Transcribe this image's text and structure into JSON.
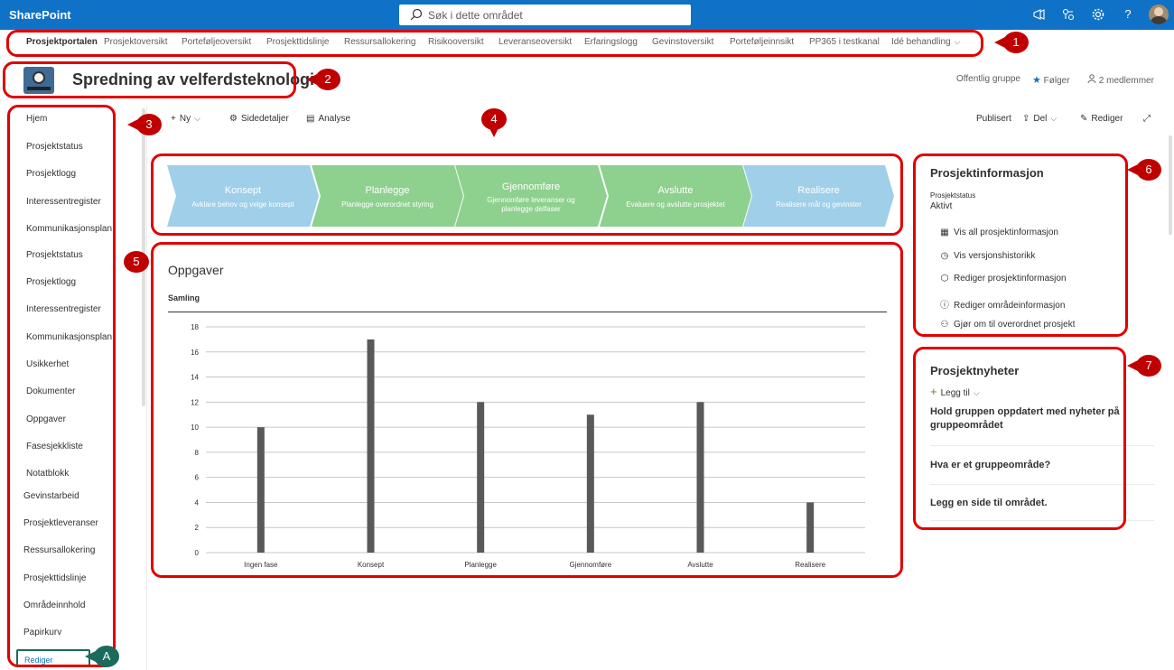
{
  "suitebar": {
    "brand": "SharePoint",
    "search_placeholder": "Søk i dette området",
    "icons": [
      "megaphone-icon",
      "share-icon",
      "gear-icon",
      "help-icon",
      "avatar"
    ]
  },
  "hubnav": {
    "items": [
      "Prosjektportalen",
      "Prosjektoversikt",
      "Porteføljeoversikt",
      "Prosjekttidslinje",
      "Ressursallokering",
      "Risikooversikt",
      "Leveranseoversikt",
      "Erfaringslogg",
      "Gevinstoversikt",
      "Porteføljeinnsikt",
      "PP365 i testkanal",
      "Idé behandling"
    ]
  },
  "site": {
    "title": "Spredning av velferdsteknologi",
    "group_type": "Offentlig gruppe",
    "follow": "Følger",
    "members": "2 medlemmer"
  },
  "leftnav": {
    "items": [
      "Hjem",
      "Prosjektstatus",
      "Prosjektlogg",
      "Interessentregister",
      "Kommunikasjonsplan",
      "Prosjektstatus",
      "Prosjektlogg",
      "Interessentregister",
      "Kommunikasjonsplan",
      "Usikkerhet",
      "Dokumenter",
      "Oppgaver",
      "Fasesjekkliste",
      "Notatblokk",
      "Gevinstarbeid",
      "Prosjektleveranser",
      "Ressursallokering",
      "Prosjekttidslinje",
      "Områdeinnhold",
      "Papirkurv"
    ],
    "edit": "Rediger"
  },
  "commandbar": {
    "new": "Ny",
    "page_details": "Sidedetaljer",
    "analytics": "Analyse",
    "published": "Publisert",
    "share": "Del",
    "edit": "Rediger"
  },
  "phases": [
    {
      "title": "Konsept",
      "desc": "Avklare behov og velge konsept",
      "color": "#9fcfe9"
    },
    {
      "title": "Planlegge",
      "desc": "Planlegge overordnet styring",
      "color": "#8ed08e"
    },
    {
      "title": "Gjennomføre",
      "desc": "Gjennomføre leveranser og planlegge delfaser",
      "color": "#8ed08e"
    },
    {
      "title": "Avslutte",
      "desc": "Evaluere og avslutte prosjektet",
      "color": "#8ed08e"
    },
    {
      "title": "Realisere",
      "desc": "Realisere mål og gevinster",
      "color": "#9fcfe9"
    }
  ],
  "tasks": {
    "title": "Oppgaver",
    "collection": "Samling"
  },
  "chart_data": {
    "type": "bar",
    "categories": [
      "Ingen fase",
      "Konsept",
      "Planlegge",
      "Gjennomføre",
      "Avslutte",
      "Realisere"
    ],
    "values": [
      10,
      17,
      12,
      11,
      12,
      4
    ],
    "yticks": [
      "0",
      "2",
      "4",
      "6",
      "8",
      "10",
      "12",
      "14",
      "16",
      "18"
    ],
    "ylim": [
      0,
      18
    ],
    "grid": true,
    "bar_color": "#595959"
  },
  "project_info": {
    "title": "Prosjektinformasjon",
    "status_label": "Prosjektstatus",
    "status_value": "Aktivt",
    "links": [
      "Vis all prosjektinformasjon",
      "Vis versjonshistorikk",
      "Rediger prosjektinformasjon",
      "Rediger områdeinformasjon",
      "Gjør om til overordnet prosjekt"
    ]
  },
  "news": {
    "title": "Prosjektnyheter",
    "add": "Legg til",
    "items": [
      "Hold gruppen oppdatert med nyheter på gruppeområdet",
      "Hva er et gruppeområde?",
      "Legg en side til området."
    ]
  },
  "callouts": [
    "1",
    "2",
    "3",
    "4",
    "5",
    "6",
    "7",
    "A"
  ],
  "colors": {
    "suitebar": "#0f72c6",
    "annotation_red": "#e00000",
    "callout_red": "#c00000",
    "callout_teal": "#1b6b5c"
  }
}
